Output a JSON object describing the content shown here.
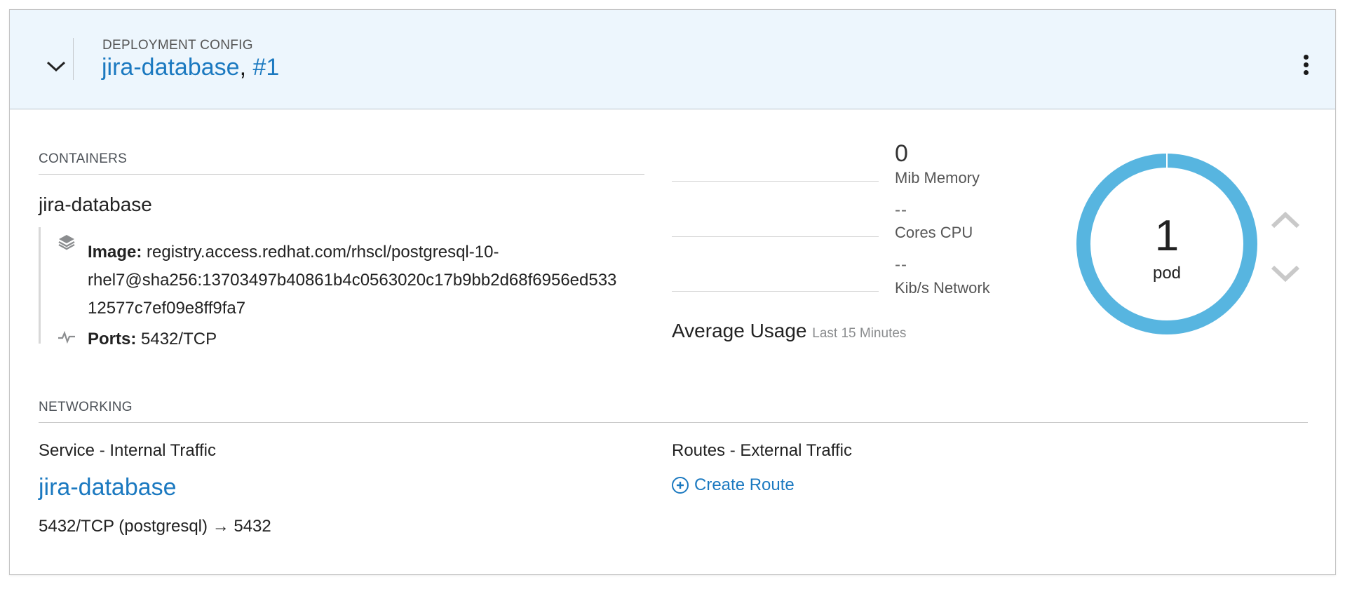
{
  "header": {
    "kind": "DEPLOYMENT CONFIG",
    "name": "jira-database",
    "separator": ",",
    "revision": "#1"
  },
  "containers": {
    "label": "CONTAINERS",
    "name": "jira-database",
    "image_label": "Image:",
    "image_line1": "registry.access.redhat.com/rhscl/postgresql-10-",
    "image_line2": "rhel7@sha256:13703497b40861b4c0563020c17b9bb2d68f6956ed533",
    "image_line3": "12577c7ef09e8ff9fa7",
    "ports_label": "Ports:",
    "ports_value": "5432/TCP"
  },
  "metrics": {
    "memory_value": "0",
    "memory_label": "Mib Memory",
    "cpu_value": "--",
    "cpu_label": "Cores CPU",
    "network_value": "--",
    "network_label": "Kib/s Network",
    "avg_label": "Average Usage",
    "avg_sub": "Last 15 Minutes"
  },
  "pods": {
    "count": "1",
    "label": "pod",
    "ring_color": "#57b5e0"
  },
  "networking": {
    "label": "NETWORKING",
    "service_title": "Service - Internal Traffic",
    "service_name": "jira-database",
    "port_left": "5432/TCP (postgresql)",
    "port_arrow": "→",
    "port_right": "5432",
    "routes_title": "Routes - External Traffic",
    "create_route": "Create Route"
  },
  "icons": {
    "toggle": "chevron-down-icon",
    "kebab": "kebab-menu-icon",
    "image": "layers-icon",
    "ports": "pulse-icon",
    "scale_up": "chevron-up-icon",
    "scale_down": "chevron-down-icon",
    "create": "plus-circle-icon"
  },
  "colors": {
    "link": "#1b79c0",
    "header_bg": "#edf6fd"
  }
}
